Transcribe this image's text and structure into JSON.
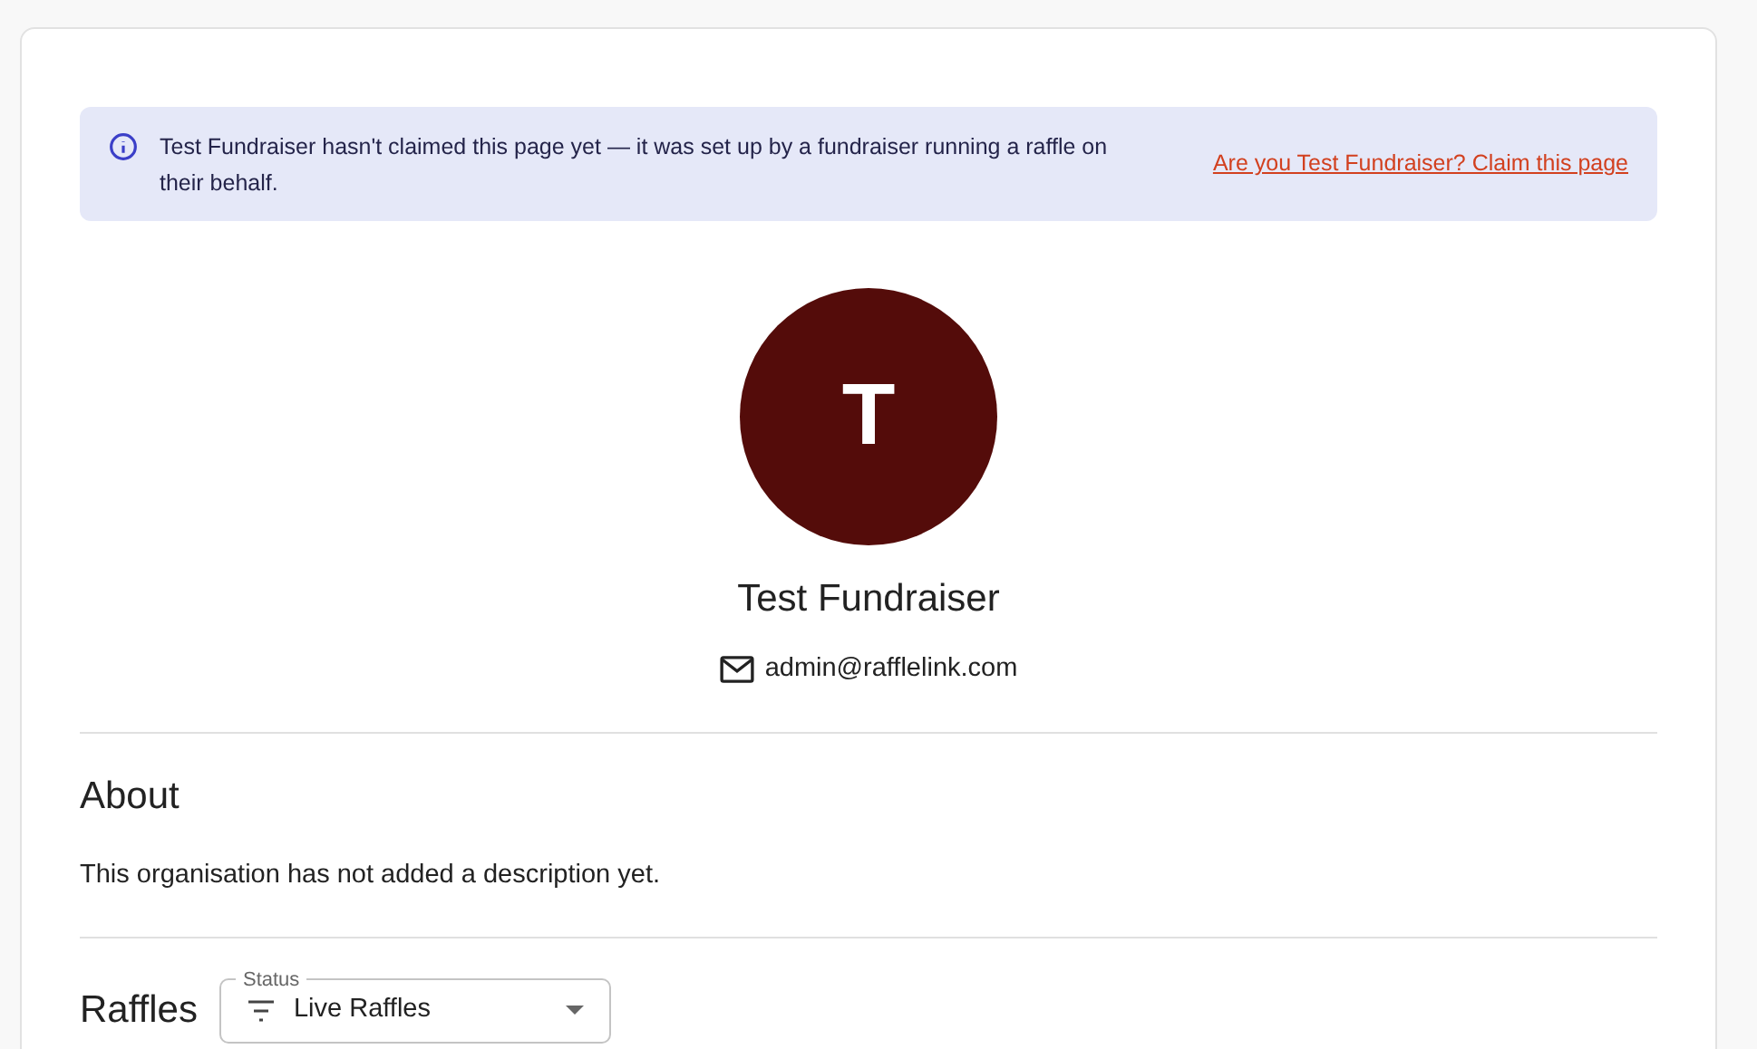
{
  "notice": {
    "text": "Test Fundraiser hasn't claimed this page yet — it was set up by a fundraiser running a raffle on their behalf.",
    "link": "Are you Test Fundraiser? Claim this page"
  },
  "profile": {
    "initial": "T",
    "name": "Test Fundraiser",
    "email": "admin@rafflelink.com"
  },
  "about": {
    "heading": "About",
    "text": "This organisation has not added a description yet."
  },
  "raffles": {
    "heading": "Raffles",
    "filter": {
      "label": "Status",
      "value": "Live Raffles"
    }
  }
}
